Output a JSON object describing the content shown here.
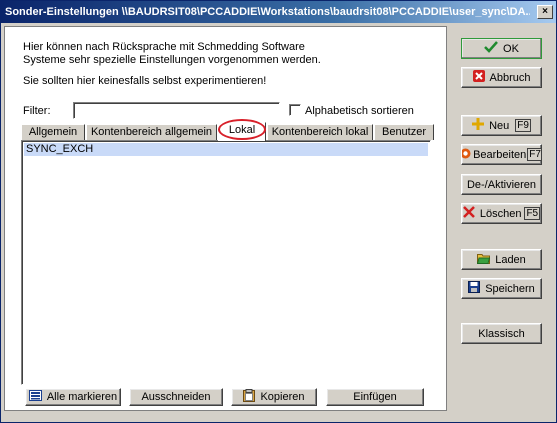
{
  "window": {
    "title": "Sonder-Einstellungen \\\\BAUDRSIT08\\PCCADDIE\\Workstations\\baudrsit08\\PCCADDIE\\user_sync\\DA..."
  },
  "info": {
    "line1": "Hier können nach Rücksprache mit Schmedding Software",
    "line2": "Systeme sehr spezielle Einstellungen vorgenommen werden.",
    "warning": "Sie sollten hier keinesfalls selbst experimentieren!"
  },
  "filter": {
    "label": "Filter:",
    "value": "",
    "checkbox_label": "Alphabetisch sortieren"
  },
  "tabs": [
    {
      "label": "Allgemein"
    },
    {
      "label": "Kontenbereich allgemein"
    },
    {
      "label": "Lokal"
    },
    {
      "label": "Kontenbereich lokal"
    },
    {
      "label": "Benutzer"
    }
  ],
  "active_tab": "Lokal",
  "list": {
    "items": [
      "SYNC_EXCH"
    ]
  },
  "bottom_buttons": {
    "alle_markieren": "Alle markieren",
    "ausschneiden": "Ausschneiden",
    "kopieren": "Kopieren",
    "einfuegen": "Einfügen"
  },
  "side_buttons": {
    "ok": "OK",
    "abbruch": "Abbruch",
    "neu": "Neu",
    "neu_key": "F9",
    "bearbeiten": "Bearbeiten",
    "bearbeiten_key": "F7",
    "deaktivieren": "De-/Aktivieren",
    "loeschen": "Löschen",
    "loeschen_key": "F5",
    "laden": "Laden",
    "speichern": "Speichern",
    "klassisch": "Klassisch"
  },
  "colors": {
    "titlebar": "#0a246a",
    "highlight_circle": "#d8202a",
    "selection": "#c9daf8",
    "ok_accent": "#2f9a3a"
  }
}
